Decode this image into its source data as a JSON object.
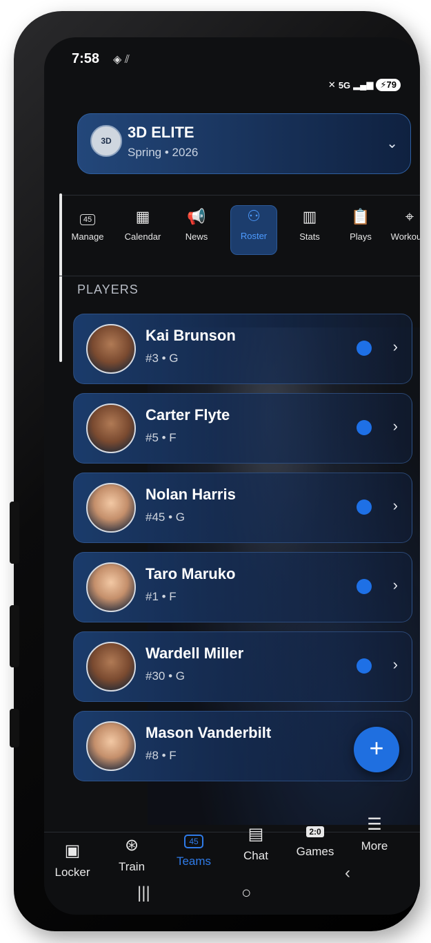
{
  "status_bar": {
    "time": "7:58",
    "left_icons": "◈ ⫽",
    "network": "5G",
    "battery": "79"
  },
  "team": {
    "name": "3D ELITE",
    "season": "Spring • 2026",
    "logo_text": "3D"
  },
  "top_nav": [
    {
      "label": "Manage",
      "icon": "jersey-icon"
    },
    {
      "label": "Calendar",
      "icon": "calendar-icon"
    },
    {
      "label": "News",
      "icon": "megaphone-icon"
    },
    {
      "label": "Roster",
      "icon": "people-icon",
      "active": true
    },
    {
      "label": "Stats",
      "icon": "bar-chart-icon"
    },
    {
      "label": "Plays",
      "icon": "clipboard-icon"
    },
    {
      "label": "Workouts",
      "icon": "crosshair-icon"
    }
  ],
  "section_title": "PLAYERS",
  "players": [
    {
      "name": "Kai Brunson",
      "meta": "#3 • G"
    },
    {
      "name": "Carter Flyte",
      "meta": "#5 • F"
    },
    {
      "name": "Nolan Harris",
      "meta": "#45 • G"
    },
    {
      "name": "Taro Maruko",
      "meta": "#1 • F"
    },
    {
      "name": "Wardell Miller",
      "meta": "#30 • G"
    },
    {
      "name": "Mason Vanderbilt",
      "meta": "#8 • F"
    }
  ],
  "fab_label": "+",
  "bottom_tabs": [
    {
      "label": "Locker",
      "icon": "locker-icon"
    },
    {
      "label": "Train",
      "icon": "basketball-icon"
    },
    {
      "label": "Teams",
      "icon": "jersey-icon",
      "active": true
    },
    {
      "label": "Chat",
      "icon": "chat-icon"
    },
    {
      "label": "Games",
      "icon": "scoreboard-icon"
    },
    {
      "label": "More",
      "icon": "menu-icon"
    }
  ],
  "nav_icons": {
    "jersey": "45",
    "scoreboard": "2:0"
  }
}
